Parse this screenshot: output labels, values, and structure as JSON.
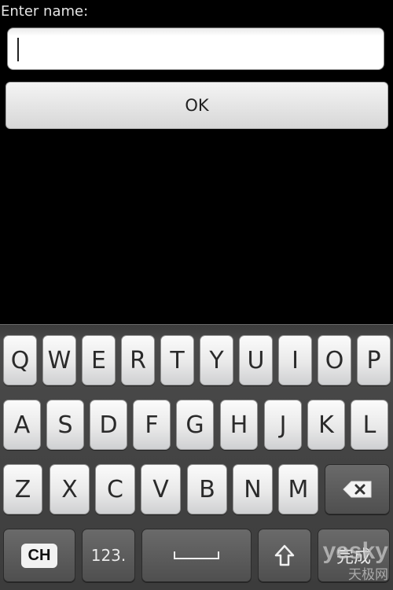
{
  "prompt": {
    "label": "Enter name:"
  },
  "name_input": {
    "value": ""
  },
  "ok_button": {
    "label": "OK"
  },
  "keyboard": {
    "row1": [
      "Q",
      "W",
      "E",
      "R",
      "T",
      "Y",
      "U",
      "I",
      "O",
      "P"
    ],
    "row2": [
      "A",
      "S",
      "D",
      "F",
      "G",
      "H",
      "J",
      "K",
      "L"
    ],
    "row3": [
      "Z",
      "X",
      "C",
      "V",
      "B",
      "N",
      "M"
    ],
    "lang_key": "CH",
    "numbers_key": "123.",
    "done_key": "完成",
    "icons": {
      "backspace": "backspace-icon",
      "shift": "shift-icon",
      "space": "space-icon"
    }
  },
  "watermark": {
    "text": "yesky",
    "sub": "天极网"
  }
}
